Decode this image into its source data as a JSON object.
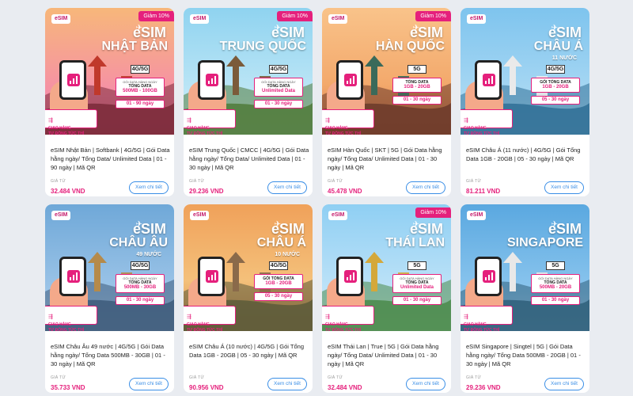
{
  "colors": {
    "accent": "#e5207c",
    "button_blue": "#3a8ee6",
    "background": "#e9ecf1"
  },
  "common": {
    "logo": "eSIM",
    "discount": "Giảm 10%",
    "delivery_line1": "GIAO HÀNG",
    "delivery_line2": "TỰ ĐỘNG TỨC THÌ",
    "from_label": "GIÁ TỪ",
    "detail_button": "Xem chi tiết",
    "banner_esim": "eSIM"
  },
  "products": [
    {
      "country": "NHẬT BẢN",
      "sub": "",
      "network": "4G/5G",
      "caption": "GÓI DATA HÀNG NGÀY",
      "data_label": "TỔNG DATA",
      "data_value": "500MB - 100GB",
      "days": "01 - 90 ngày",
      "discount": true,
      "theme": "japan",
      "title": "eSIM Nhật Bản | Softbank | 4G/5G | Gói Data hằng ngày/ Tổng Data/ Unlimited Data | 01 - 90 ngày | Mã QR",
      "price": "32.484 VND"
    },
    {
      "country": "TRUNG QUỐC",
      "sub": "",
      "network": "4G/5G",
      "caption": "GÓI DATA HÀNG NGÀY",
      "data_label": "TỔNG DATA",
      "data_value": "Unlimited Data",
      "days": "01 - 30 ngày",
      "discount": true,
      "theme": "china",
      "title": "eSIM Trung Quốc | CMCC | 4G/5G | Gói Data hằng ngày/ Tổng Data/ Unlimited Data | 01 - 30 ngày | Mã QR",
      "price": "29.236 VND"
    },
    {
      "country": "HÀN QUỐC",
      "sub": "",
      "network": "5G",
      "caption": "",
      "data_label": "TỔNG DATA",
      "data_value": "1GB - 20GB",
      "days": "01 - 30 ngày",
      "discount": true,
      "theme": "korea",
      "title": "eSIM Hàn Quốc | SKT | 5G | Gói Data hằng ngày/ Tổng Data/ Unlimited Data | 01 - 30 ngày | Mã QR",
      "price": "45.478 VND"
    },
    {
      "country": "CHÂU Á",
      "sub": "11 NƯỚC",
      "network": "4G/5G",
      "caption": "",
      "data_label": "GÓI TỔNG DATA",
      "data_value": "1GB - 20GB",
      "days": "05 - 30 ngày",
      "discount": false,
      "theme": "sydney",
      "title": "eSIM Châu Á (11 nước) | 4G/5G | Gói Tổng Data 1GB - 20GB | 05 - 30 ngày | Mã QR",
      "price": "81.211 VND"
    },
    {
      "country": "CHÂU ÂU",
      "sub": "49 NƯỚC",
      "network": "4G/5G",
      "caption": "GÓI DATA HÀNG NGÀY",
      "data_label": "TỔNG DATA",
      "data_value": "500MB - 30GB",
      "days": "01 - 30 ngày",
      "discount": false,
      "theme": "london",
      "title": "eSIM Châu Âu 49 nước | 4G/5G | Gói Data hằng ngày/ Tổng Data 500MB - 30GB | 01 - 30 ngày | Mã QR",
      "price": "35.733 VND"
    },
    {
      "country": "CHÂU Á",
      "sub": "10 NƯỚC",
      "network": "4G/5G",
      "caption": "",
      "data_label": "GÓI TỔNG DATA",
      "data_value": "1GB - 20GB",
      "days": "05 - 30 ngày",
      "discount": false,
      "theme": "wall",
      "title": "eSIM Châu Á (10 nước) | 4G/5G | Gói Tổng Data 1GB - 20GB | 05 - 30 ngày | Mã QR",
      "price": "90.956 VND"
    },
    {
      "country": "THÁI LAN",
      "sub": "",
      "network": "5G",
      "caption": "GÓI DATA HÀNG NGÀY",
      "data_label": "TỔNG DATA",
      "data_value": "Unlimited Data",
      "days": "01 - 30 ngày",
      "discount": true,
      "theme": "thai",
      "title": "eSIM Thái Lan | True | 5G | Gói Data hằng ngày/ Tổng Data/ Unlimited Data | 01 - 30 ngày | Mã QR",
      "price": "32.484 VND"
    },
    {
      "country": "SINGAPORE",
      "sub": "",
      "network": "5G",
      "caption": "GÓI DATA HÀNG NGÀY",
      "data_label": "TỔNG DATA",
      "data_value": "500MB - 20GB",
      "days": "01 - 30 ngày",
      "discount": false,
      "theme": "singapore",
      "title": "eSIM Singapore | Singtel | 5G | Gói Data hằng ngày/ Tổng Data 500MB - 20GB | 01 - 30 ngày | Mã QR",
      "price": "29.236 VND"
    }
  ]
}
